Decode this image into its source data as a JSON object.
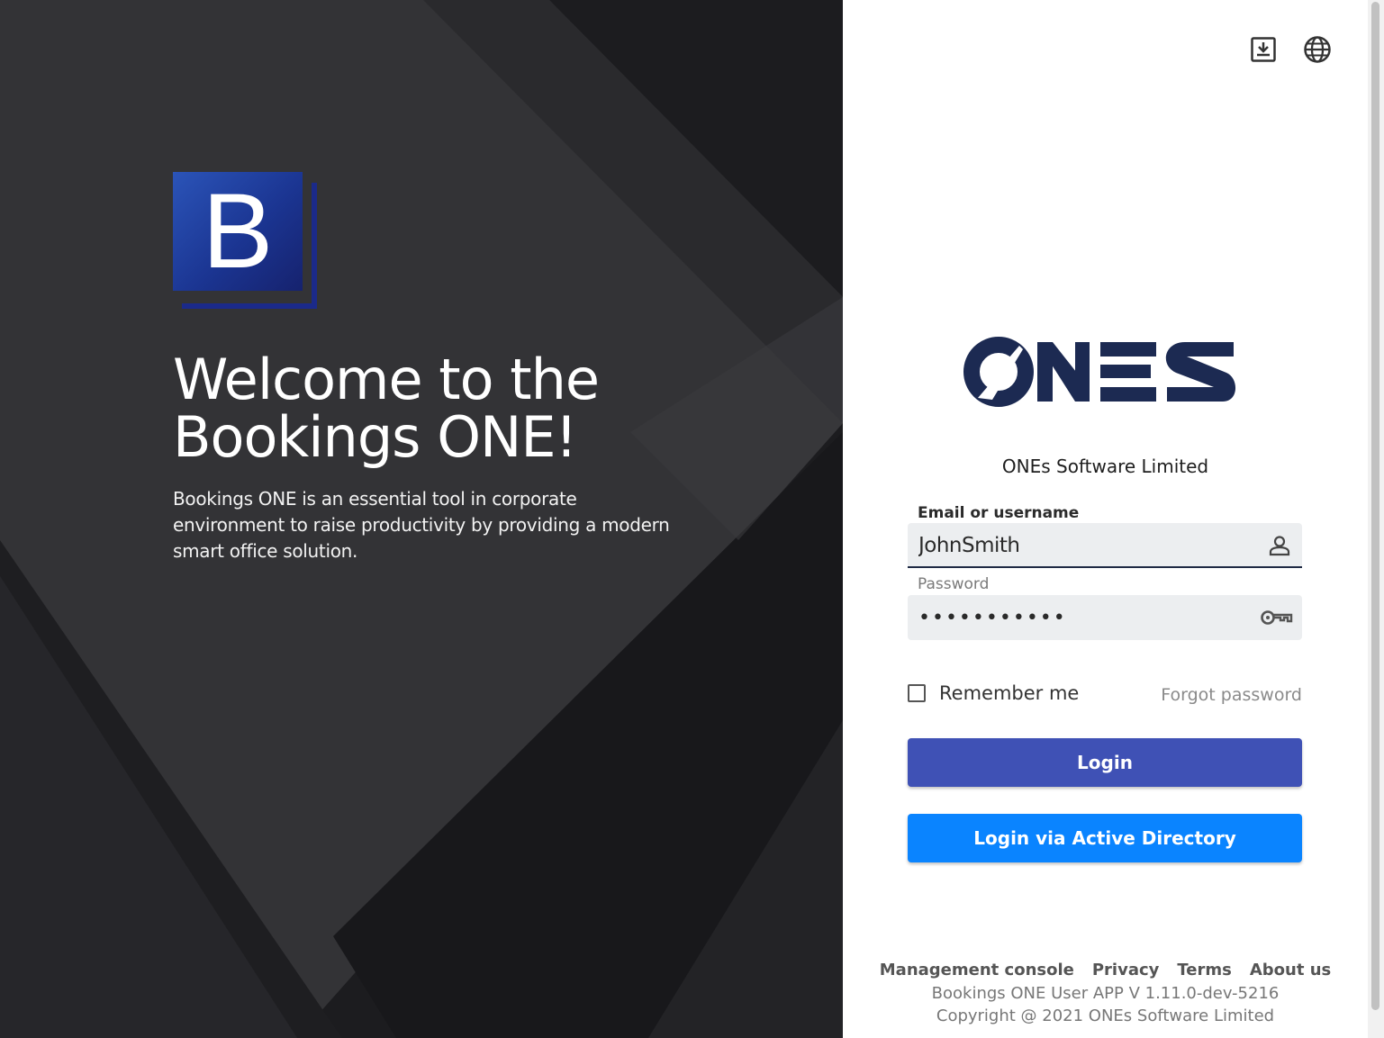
{
  "hero": {
    "logo_letter": "B",
    "title_line1": "Welcome to the",
    "title_line2": "Bookings ONE!",
    "description": "Bookings ONE is an essential tool in corporate environment to raise productivity by providing a modern smart office solution."
  },
  "header": {
    "icons": [
      "download-icon",
      "globe-icon"
    ]
  },
  "brand": {
    "logo_text": "ONES",
    "company_name": "ONEs Software Limited"
  },
  "form": {
    "email_label": "Email or username",
    "email_value": "JohnSmith",
    "password_label": "Password",
    "password_value": "•••••••••••",
    "remember_label": "Remember me",
    "remember_checked": false,
    "forgot_label": "Forgot password",
    "login_label": "Login",
    "ad_login_label": "Login via Active Directory"
  },
  "footer": {
    "links": [
      "Management console",
      "Privacy",
      "Terms",
      "About us"
    ],
    "version": "Bookings ONE User APP V 1.11.0-dev-5216",
    "copyright": "Copyright @ 2021 ONEs Software Limited"
  },
  "colors": {
    "primary_button": "#3f51b5",
    "ad_button": "#0a84ff",
    "brand_navy": "#1c2a52"
  }
}
